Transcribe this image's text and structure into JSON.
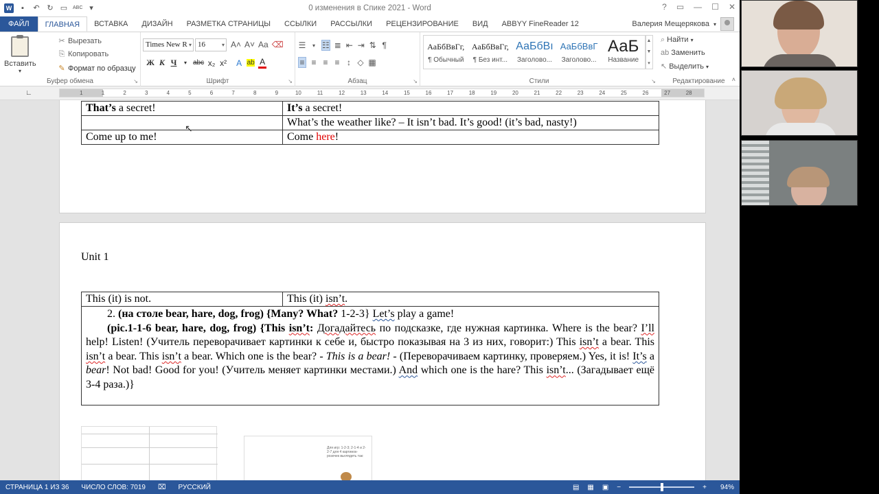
{
  "window": {
    "title": "0 изменения в Спике 2021 - Word",
    "controls": [
      "?",
      "▭",
      "—",
      "☐",
      "✕"
    ]
  },
  "quick_access": [
    "W",
    "💾",
    "↶",
    "↻",
    "📂",
    "ABC"
  ],
  "tabs": [
    {
      "label": "ФАЙЛ"
    },
    {
      "label": "ГЛАВНАЯ"
    },
    {
      "label": "ВСТАВКА"
    },
    {
      "label": "ДИЗАЙН"
    },
    {
      "label": "РАЗМЕТКА СТРАНИЦЫ"
    },
    {
      "label": "ССЫЛКИ"
    },
    {
      "label": "РАССЫЛКИ"
    },
    {
      "label": "РЕЦЕНЗИРОВАНИЕ"
    },
    {
      "label": "ВИД"
    },
    {
      "label": "ABBYY FineReader 12"
    }
  ],
  "user": {
    "name": "Валерия Мещерякова"
  },
  "ribbon": {
    "clipboard": {
      "paste": "Вставить",
      "cut": "Вырезать",
      "copy": "Копировать",
      "format_painter": "Формат по образцу",
      "label": "Буфер обмена"
    },
    "font": {
      "name": "Times New R",
      "size": "16",
      "label": "Шрифт",
      "bold": "Ж",
      "italic": "К",
      "underline": "Ч",
      "strike": "abc",
      "subscript": "x₂",
      "superscript": "x²",
      "grow": "A˄",
      "shrink": "A˅",
      "case": "Aa",
      "effects": "A",
      "highlight": "ab",
      "color": "A"
    },
    "paragraph": {
      "label": "Абзац"
    },
    "styles": {
      "label": "Стили",
      "items": [
        {
          "sample": "АаБбВвГг,",
          "name": "¶ Обычный"
        },
        {
          "sample": "АаБбВвГг,",
          "name": "¶ Без инт..."
        },
        {
          "sample": "АаБбВı",
          "name": "Заголово..."
        },
        {
          "sample": "АаБбВвГ",
          "name": "Заголово..."
        },
        {
          "sample": "АаБ",
          "name": "Название"
        }
      ]
    },
    "editing": {
      "label": "Редактирование",
      "find": "Найти",
      "replace": "Заменить",
      "select": "Выделить"
    }
  },
  "ruler": {
    "ticks": [
      "1",
      "1",
      "2",
      "3",
      "4",
      "5",
      "6",
      "7",
      "8",
      "9",
      "10",
      "11",
      "12",
      "13",
      "14",
      "15",
      "16",
      "17",
      "18",
      "19",
      "20",
      "21",
      "22",
      "23",
      "24",
      "25",
      "26",
      "27",
      "28"
    ]
  },
  "document": {
    "table1": {
      "r1c1_bold": "That’s",
      "r1c1_rest": " a secret!",
      "r1c2_bold": "It’s",
      "r1c2_rest": " a secret!",
      "r2c2": "What’s the weather like? – It isn’t bad. It’s good! (it’s bad, nasty!)",
      "r3c1": "Come up to me!",
      "r3c2_a": "Come ",
      "r3c2_red": "here",
      "r3c2_b": "!"
    },
    "unit_title": "Unit 1",
    "table2": {
      "r1c1": "This (it) is not.",
      "r1c2_a": "This (it) ",
      "r1c2_sq": "isn’t",
      "r1c2_b": ".",
      "p1_num": "2. ",
      "p1_b1": "(на столе bear, hare, dog, frog) {Many? What?",
      "p1_t1": " 1-2-3} ",
      "p1_sq1": "Let’s",
      "p1_t2": " play a game!",
      "p2_b1": "(pic.1-1-6 bear, hare, dog, frog) {This ",
      "p2_b2": "isn’t",
      "p2_b3": ":",
      "p2_t1": " ",
      "p2_sq1": "Догадайтесь",
      "p2_t2": " по подсказке, где нужная картинка. Where is the bear? ",
      "p2_sq2": "I’ll",
      "p2_t3": " help! Listen! (Учитель переворачивает картинки к себе и, быстро показывая на 3 из них, говорит:) This ",
      "p2_sq3": "isn’t",
      "p2_t4": " a bear. This ",
      "p2_sq4": "isn’t",
      "p2_t5": " a bear. This ",
      "p2_sq5": "isn’t",
      "p2_t6": " a bear. Which one is the bear? - ",
      "p2_i1": "This is a bear!",
      "p2_t7": " - (Переворачиваем картинку, проверяем.) Yes, it is! ",
      "p2_sq6": "It’s",
      "p2_t8": " a ",
      "p2_i2": "bear",
      "p2_t9": "! Not bad! Good for you! (Учитель меняет картинки местами.) ",
      "p2_sq7": "And",
      "p2_t10": " which one is the hare? This ",
      "p2_sq8": "isn’t",
      "p2_t11": "... (Загадывает ещё 3-4 раза.)}"
    },
    "thumb_text": "Для игр: 1-2-3; 2-1-4 и 2-2-7 для 4 картинок-розочек выглядеть так:"
  },
  "statusbar": {
    "page": "СТРАНИЦА 1 ИЗ 36",
    "words": "ЧИСЛО СЛОВ: 7019",
    "language": "РУССКИЙ",
    "zoom": "94%"
  },
  "colors": {
    "accent": "#2b579a",
    "statusbar": "#2b579a"
  }
}
